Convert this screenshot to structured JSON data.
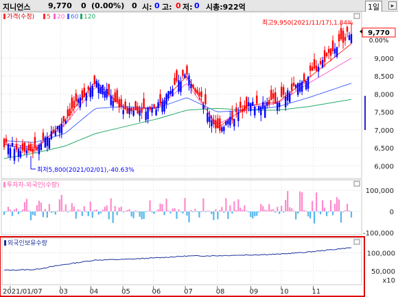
{
  "header": {
    "stock_name": "지니언스",
    "price": "9,770",
    "change": "0",
    "change_pct": "(0.00%)",
    "open_label": "시:",
    "open_value": "0",
    "high_label": "고:",
    "high_value": "0",
    "low_label": "저:",
    "low_value": "0",
    "volume_value": "0",
    "market_cap": "시총:922억",
    "period_button": "1일"
  },
  "panels": {
    "price_legend": {
      "title": "가격(수정)",
      "ma_values": [
        "5",
        "20",
        "60",
        "120"
      ],
      "ma_colors": [
        "#ff2b2b",
        "#ff66cc",
        "#4466ff",
        "#22aa66"
      ]
    },
    "investor_legend": "투자자-외국인(수량)",
    "holding_legend": "외국인보유수량"
  },
  "annotations": {
    "high": "최고9,950(2021/11/17),1.84%",
    "low": "최저5,800(2021/02/01),-40.63%",
    "current_price_tag": "9,770",
    "current_pct_tag": "0.00%"
  },
  "colors": {
    "up": "#ff0000",
    "down": "#0000ff",
    "volume_up": "#ff88cc",
    "volume_down": "#55b6ee",
    "holding_line": "#1a2f9a",
    "highlight_border": "#e00000"
  },
  "chart_data": [
    {
      "type": "candlestick",
      "title": "가격(수정)",
      "x_ticks": [
        "2021/01/07",
        "03",
        "04",
        "05",
        "06",
        "07",
        "08",
        "09",
        "10",
        "11"
      ],
      "y_ticks": [
        "6,000",
        "6,500",
        "7,000",
        "7,500",
        "8,000",
        "8,500",
        "9,000"
      ],
      "ylim": [
        5700,
        10200
      ],
      "series": [
        {
          "name": "가격",
          "x_months": [
            0,
            1,
            2,
            3,
            4,
            5,
            6,
            7,
            8,
            9,
            10,
            11.4
          ],
          "close": [
            6600,
            6400,
            7300,
            8400,
            7500,
            7650,
            8600,
            7000,
            7700,
            7800,
            8500,
            9770
          ]
        },
        {
          "name": "5",
          "values": [
            6600,
            6420,
            7280,
            8350,
            7550,
            7620,
            8500,
            7050,
            7680,
            7780,
            8450,
            9400
          ]
        },
        {
          "name": "20",
          "values": [
            6650,
            6500,
            7150,
            8200,
            7600,
            7600,
            8300,
            7150,
            7600,
            7750,
            8300,
            9000
          ]
        },
        {
          "name": "60",
          "values": [
            6700,
            6650,
            6900,
            7600,
            7650,
            7600,
            7900,
            7500,
            7550,
            7650,
            7900,
            8300
          ]
        },
        {
          "name": "120",
          "values": [
            6200,
            6350,
            6550,
            6900,
            7100,
            7300,
            7550,
            7600,
            7550,
            7550,
            7650,
            7850
          ]
        }
      ],
      "high_point": {
        "value": 9950,
        "date": "2021/11/17"
      },
      "low_point": {
        "value": 5800,
        "date": "2021/02/01"
      },
      "current": 9770
    },
    {
      "type": "bar",
      "title": "투자자-외국인(수량)",
      "y_ticks": [
        "100,000",
        "0",
        "-100,000"
      ],
      "ylim": [
        -100000,
        100000
      ]
    },
    {
      "type": "line",
      "title": "외국인보유수량",
      "y_ticks": [
        "100,000",
        "50,000"
      ],
      "y_unit": "x10",
      "x_months": [
        0,
        1,
        2,
        3,
        4,
        5,
        6,
        7,
        8,
        9,
        10,
        11.4
      ],
      "values": [
        52000,
        54000,
        68000,
        80000,
        82000,
        86000,
        91000,
        92000,
        94000,
        96000,
        102000,
        114000
      ]
    }
  ]
}
